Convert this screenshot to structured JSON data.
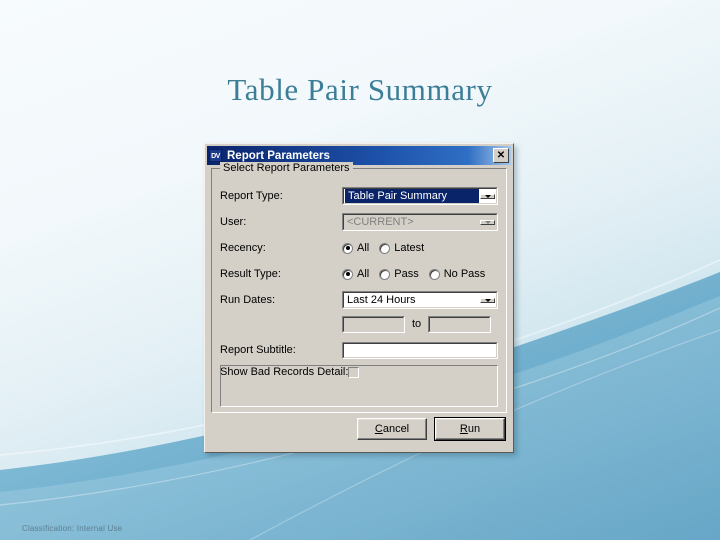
{
  "slide": {
    "title": "Table Pair Summary",
    "footer": "Classification: Internal Use",
    "title_color": "#3d7e97",
    "background_top": "#f7fbfd",
    "background_bottom": "#5fa3c4"
  },
  "dialog": {
    "app_icon_label": "DV",
    "title": "Report Parameters",
    "close_label": "✕",
    "groupbox_label": "Select Report Parameters",
    "rows": {
      "report_type": {
        "label": "Report Type:",
        "value": "Table Pair Summary",
        "state": "focused"
      },
      "user": {
        "label": "User:",
        "value": "<CURRENT>",
        "state": "disabled"
      },
      "recency": {
        "label": "Recency:",
        "options": [
          {
            "label": "All",
            "checked": true
          },
          {
            "label": "Latest",
            "checked": false
          }
        ]
      },
      "result_type": {
        "label": "Result Type:",
        "options": [
          {
            "label": "All",
            "checked": true
          },
          {
            "label": "Pass",
            "checked": false
          },
          {
            "label": "No Pass",
            "checked": false
          }
        ]
      },
      "run_dates": {
        "label": "Run Dates:",
        "value": "Last 24 Hours",
        "from_value": "",
        "to_label": "to",
        "to_value": "",
        "state": "enabled"
      },
      "report_subtitle": {
        "label": "Report Subtitle:",
        "value": "",
        "placeholder": ""
      },
      "show_bad_records": {
        "label": "Show Bad Records Detail:",
        "checked": false
      }
    },
    "buttons": {
      "cancel": {
        "prefix": "",
        "mnemonic": "C",
        "suffix": "ancel"
      },
      "run": {
        "prefix": "",
        "mnemonic": "R",
        "suffix": "un",
        "is_default": true
      }
    }
  }
}
